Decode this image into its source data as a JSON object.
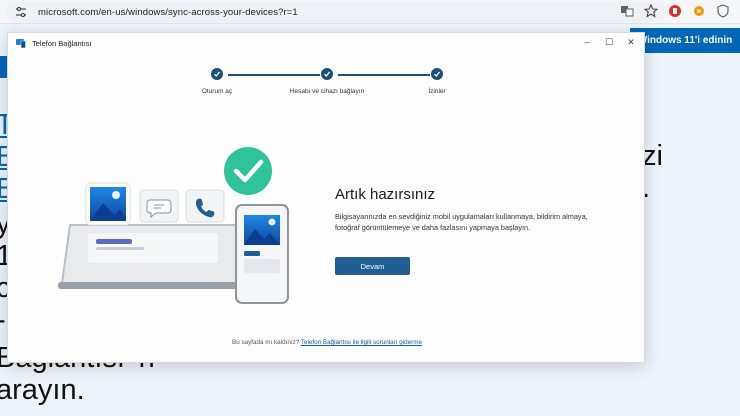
{
  "browser": {
    "url": "microsoft.com/en-us/windows/sync-across-your-devices?r=1"
  },
  "background_page": {
    "cta_label": "Windows 11'i edinin",
    "left_fragments": [
      "Te",
      "B",
      "B",
      "yo",
      "1",
      "cu",
      "-"
    ],
    "bottom_line_1": "Bağlantısı' n",
    "bottom_line_2": "arayın.",
    "right_fragments": [
      "zi",
      "."
    ]
  },
  "window": {
    "title": "Telefon Bağlantısı",
    "minimize": "–",
    "maximize": "☐",
    "close": "✕"
  },
  "stepper": {
    "steps": [
      {
        "label": "Oturum aç"
      },
      {
        "label": "Hesabı ve cihazı bağlayın"
      },
      {
        "label": "İzinler"
      }
    ]
  },
  "content": {
    "heading": "Artık hazırsınız",
    "description": "Bilgisayarınızda en sevdiğiniz mobil uygulamaları kullanmaya, bildirim almaya, fotoğraf görüntülemeye ve daha fazlasını yapmaya başlayın.",
    "primary_button": "Devam",
    "footer_text": "Bu sayfada mı kaldınız?",
    "footer_link": "Telefon Bağlantısı ile ilgili sorunları giderme"
  },
  "colors": {
    "accent": "#1f5f93",
    "check_green": "#2fc39a",
    "step_navy": "#1b4f7a"
  }
}
